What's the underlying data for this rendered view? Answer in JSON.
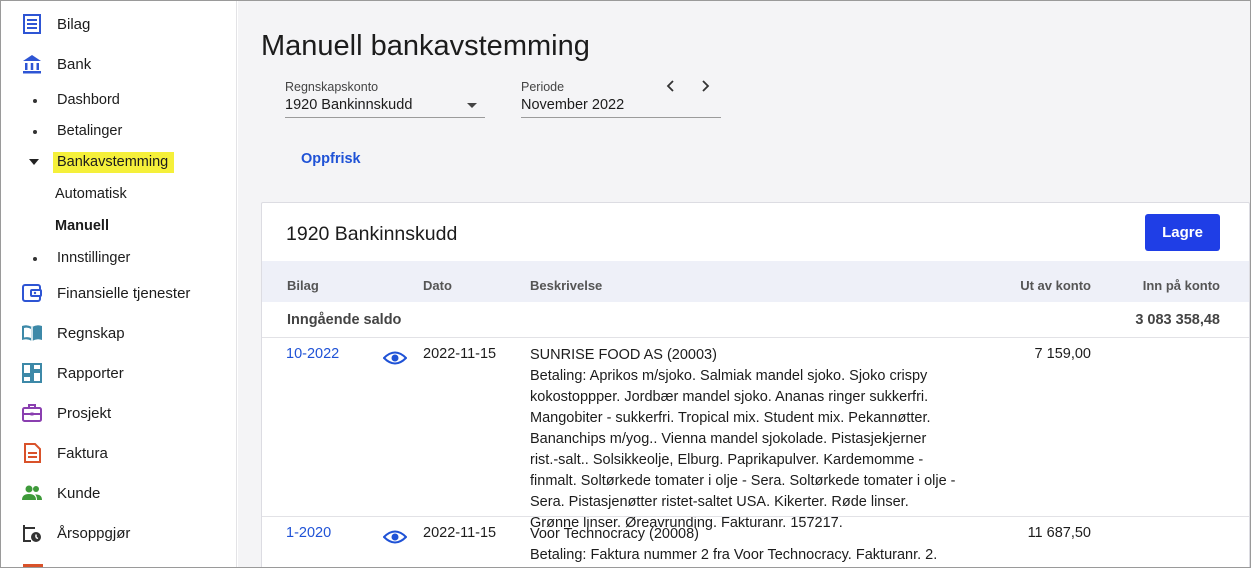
{
  "sidebar": {
    "items": [
      {
        "label": "Bilag",
        "icon": "receipt-icon"
      },
      {
        "label": "Bank",
        "icon": "bank-icon"
      },
      {
        "label": "Finansielle tjenester",
        "icon": "wallet-icon"
      },
      {
        "label": "Regnskap",
        "icon": "book-icon"
      },
      {
        "label": "Rapporter",
        "icon": "dashboard-icon"
      },
      {
        "label": "Prosjekt",
        "icon": "briefcase-icon"
      },
      {
        "label": "Faktura",
        "icon": "document-icon"
      },
      {
        "label": "Kunde",
        "icon": "people-icon"
      },
      {
        "label": "Årsoppgjør",
        "icon": "calendar-clock-icon"
      }
    ],
    "bank_sub": {
      "dashbord": "Dashbord",
      "betalinger": "Betalinger",
      "bankavstemming": "Bankavstemming",
      "automatisk": "Automatisk",
      "manuell": "Manuell",
      "innstillinger": "Innstillinger"
    },
    "accent_color": "#1f52d6",
    "highlight_color": "#f5f03a"
  },
  "page": {
    "title": "Manuell bankavstemming",
    "account_field": {
      "label": "Regnskapskonto",
      "value": "1920 Bankinnskudd"
    },
    "period_field": {
      "label": "Periode",
      "value": "November 2022"
    },
    "refresh_label": "Oppfrisk"
  },
  "card": {
    "title": "1920 Bankinnskudd",
    "save_label": "Lagre",
    "columns": {
      "bilag": "Bilag",
      "dato": "Dato",
      "beskrivelse": "Beskrivelse",
      "ut": "Ut av konto",
      "inn": "Inn på konto"
    },
    "opening": {
      "label": "Inngående saldo",
      "inn": "3 083 358,48"
    },
    "rows": [
      {
        "bilag": "10-2022",
        "dato": "2022-11-15",
        "title": "SUNRISE FOOD AS (20003)",
        "desc_lines": [
          "Betaling: Aprikos m/sjoko. Salmiak mandel sjoko. Sjoko crispy",
          "kokostoppper. Jordbær mandel sjoko. Ananas ringer sukkerfri.",
          "Mangobiter - sukkerfri. Tropical mix. Student mix. Pekannøtter.",
          "Bananchips m/yog.. Vienna mandel sjokolade. Pistasjekjerner",
          "rist.-salt.. Solsikkeolje, Elburg. Paprikapulver. Kardemomme -",
          "finmalt. Soltørkede tomater i olje - Sera. Soltørkede tomater i olje -",
          "Sera. Pistasjenøtter ristet-saltet USA. Kikerter. Røde linser.",
          "Grønne linser. Øreavrunding. Fakturanr. 157217."
        ],
        "ut": "7 159,00"
      },
      {
        "bilag": "1-2020",
        "dato": "2022-11-15",
        "title": "Voor Technocracy (20008)",
        "desc_lines": [
          "Betaling: Faktura nummer 2 fra Voor Technocracy. Fakturanr. 2."
        ],
        "ut": "11 687,50"
      }
    ]
  }
}
